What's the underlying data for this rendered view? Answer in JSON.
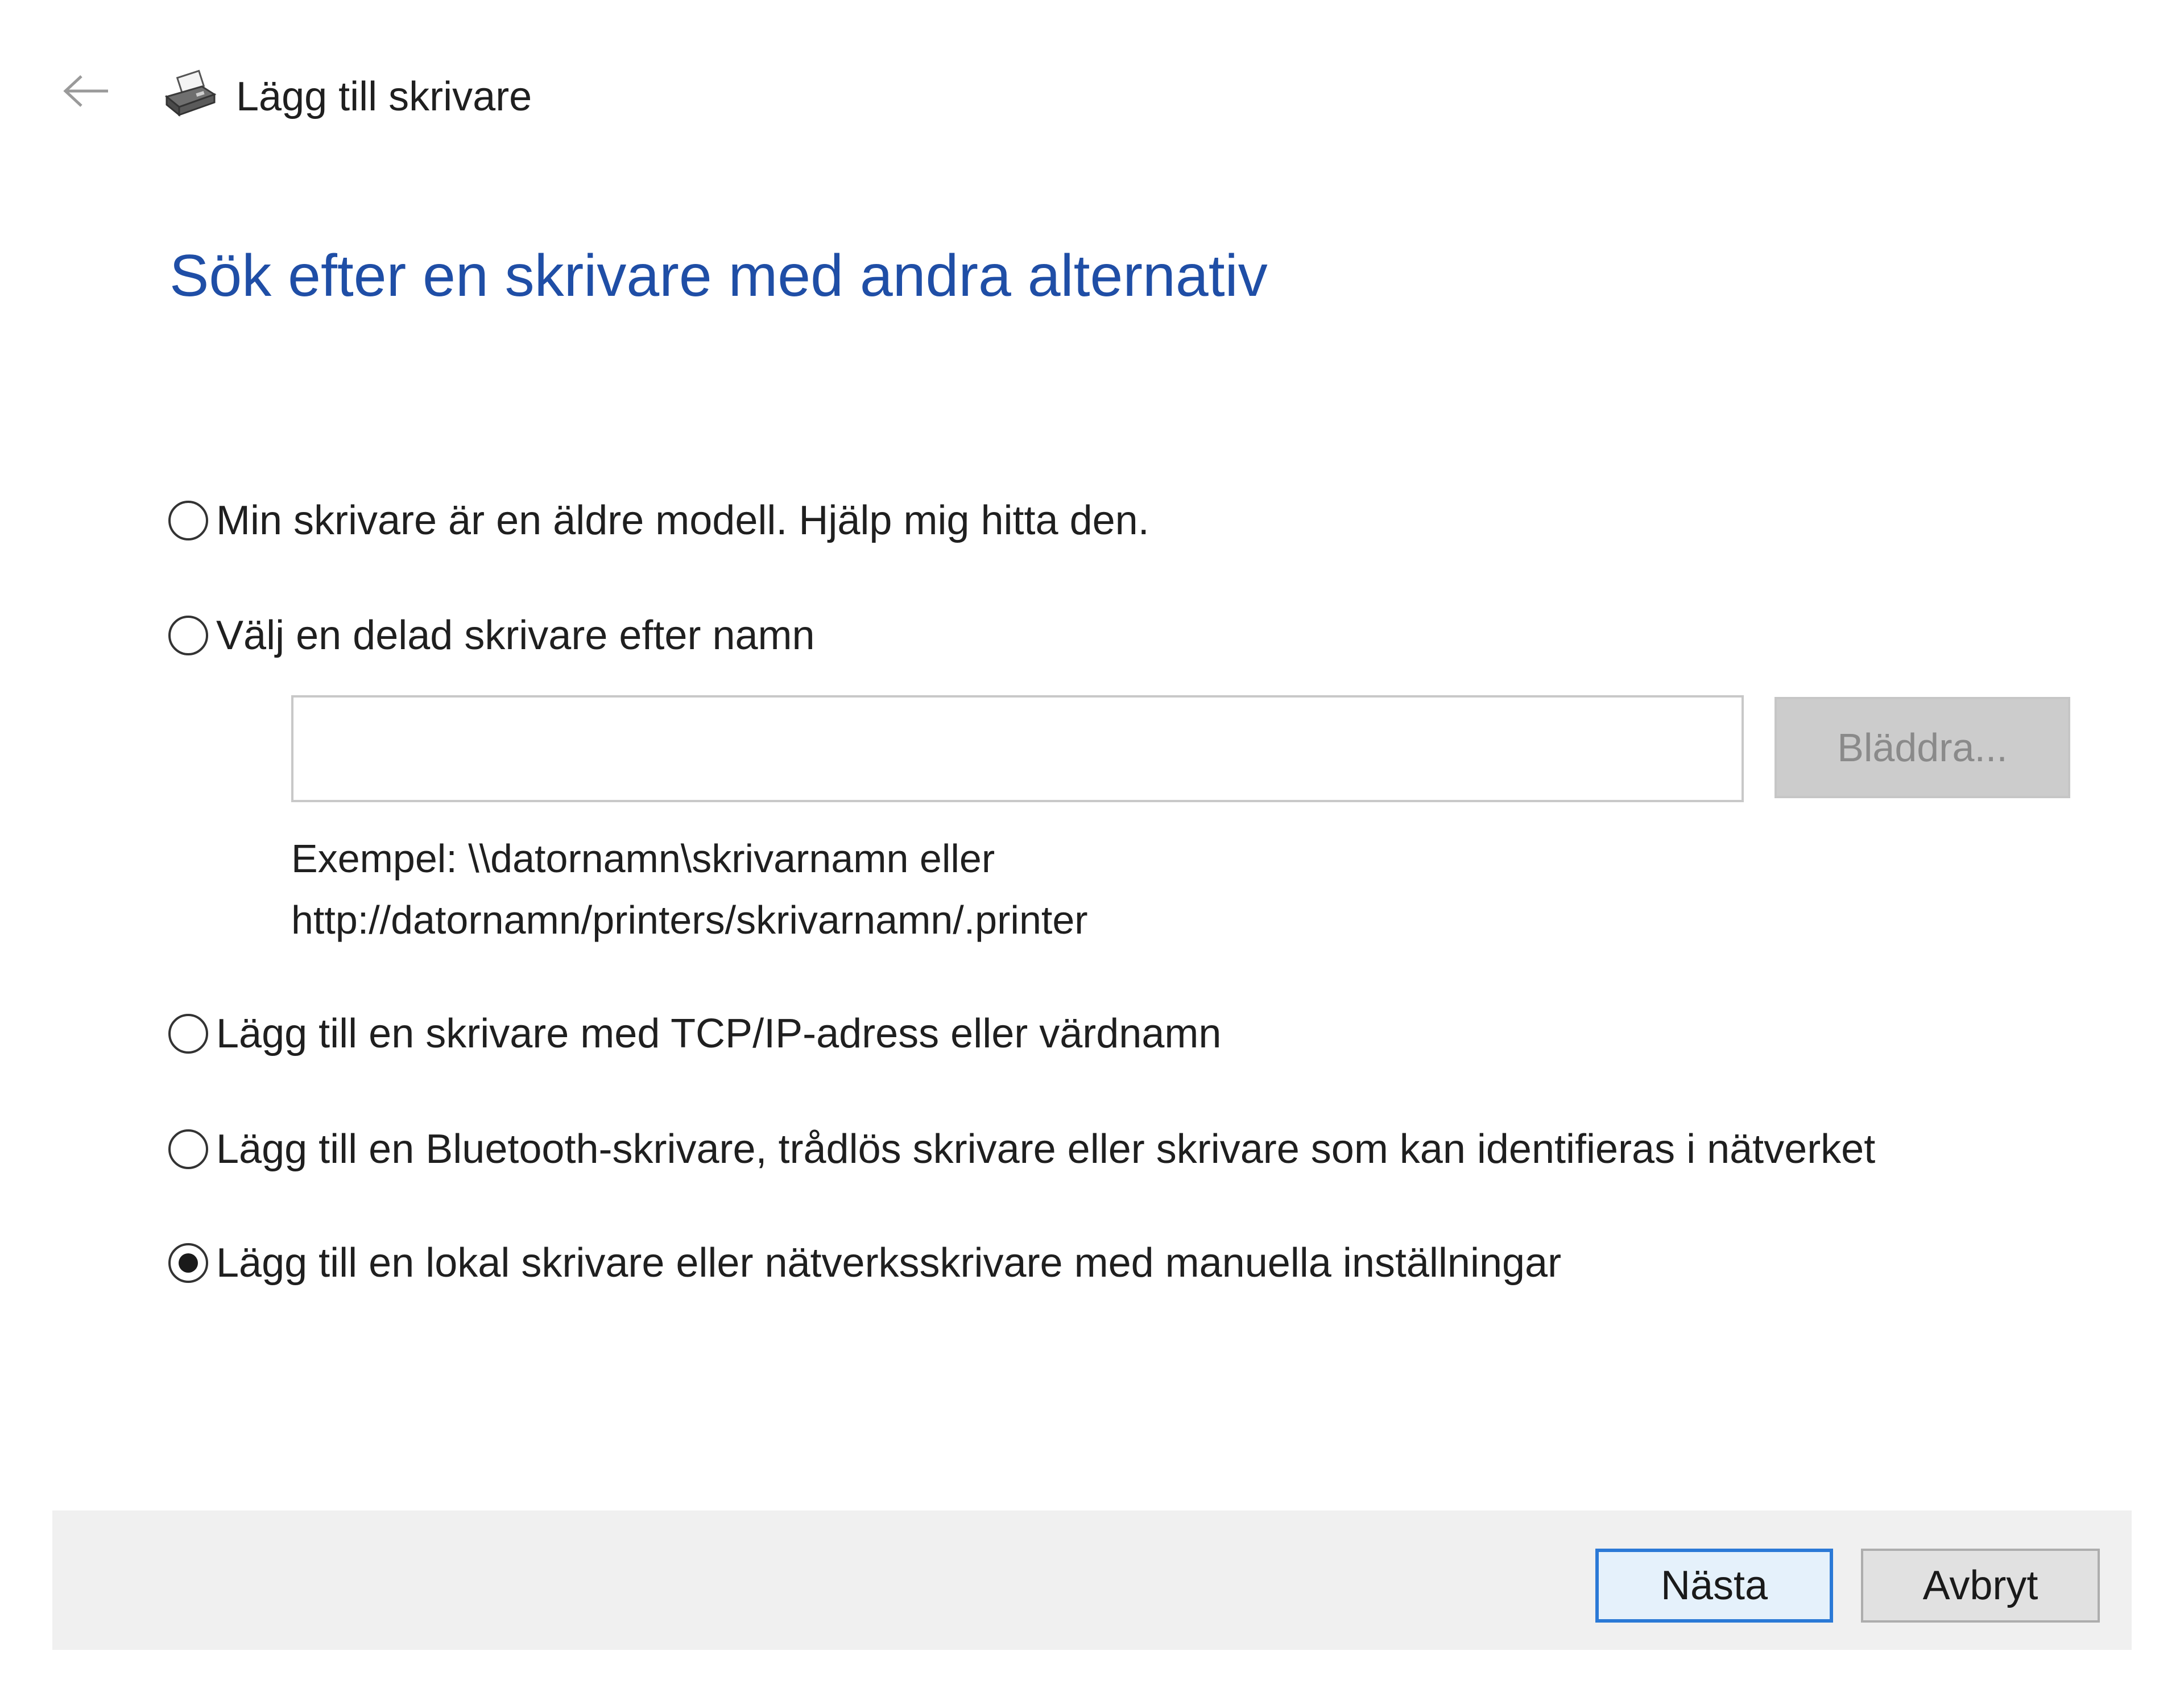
{
  "header": {
    "back_icon": "back-arrow-icon",
    "app_icon": "printer-icon",
    "title": "Lägg till skrivare"
  },
  "main": {
    "heading": "Sök efter en skrivare med andra alternativ",
    "options": [
      {
        "label": "Min skrivare är en äldre modell. Hjälp mig hitta den.",
        "selected": false
      },
      {
        "label": "Välj en delad skrivare efter namn",
        "selected": false
      },
      {
        "label": "Lägg till en skrivare med TCP/IP-adress eller värdnamn",
        "selected": false
      },
      {
        "label": "Lägg till en Bluetooth-skrivare, trådlös skrivare eller skrivare som kan identifieras i nätverket",
        "selected": false
      },
      {
        "label": "Lägg till en lokal skrivare eller nätverksskrivare med manuella inställningar",
        "selected": true
      }
    ],
    "shared_printer": {
      "value": "",
      "placeholder": "",
      "browse_label": "Bläddra...",
      "example_line1": "Exempel: \\\\datornamn\\skrivarnamn eller",
      "example_line2": "http://datornamn/printers/skrivarnamn/.printer"
    }
  },
  "footer": {
    "next_label": "Nästa",
    "cancel_label": "Avbryt"
  },
  "colors": {
    "heading": "#1f4ea6",
    "default_button_border": "#2b79d6",
    "footer_background": "#f0f0f0",
    "disabled_button_background": "#cccccc"
  }
}
